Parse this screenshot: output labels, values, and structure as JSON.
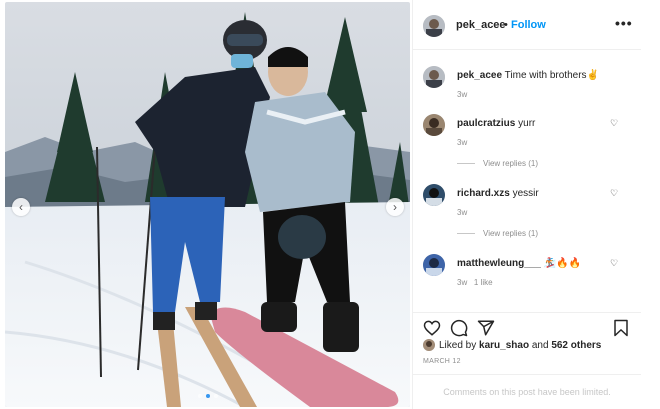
{
  "post": {
    "username": "pek_acee",
    "separator": "•",
    "follow_label": "Follow",
    "more_label": "•••",
    "nav_prev": "‹",
    "nav_next": "›",
    "slide_count": 3,
    "active_slide": 1
  },
  "comments": [
    {
      "username": "pek_acee",
      "text": "Time with brothers✌️",
      "time": "3w",
      "likes": "",
      "replies": "",
      "likeable": false
    },
    {
      "username": "paulcratzius",
      "text": "yurr",
      "time": "3w",
      "likes": "",
      "replies": "View replies (1)",
      "likeable": true
    },
    {
      "username": "richard.xzs",
      "text": "yessir",
      "time": "3w",
      "likes": "",
      "replies": "View replies (1)",
      "likeable": true
    },
    {
      "username": "matthewleung___",
      "text": "🏂🔥🔥",
      "time": "3w",
      "likes": "1 like",
      "replies": "",
      "likeable": true
    }
  ],
  "actions": {
    "icons": [
      "heart-icon",
      "comment-icon",
      "share-icon",
      "bookmark-icon"
    ]
  },
  "likes": {
    "prefix": "Liked by ",
    "user": "karu_shao",
    "middle": " and ",
    "others": "562 others"
  },
  "date": "MARCH 12",
  "comments_limited": "Comments on this post have been limited.",
  "icons": {
    "like": "heart-icon",
    "more": "more-icon"
  }
}
